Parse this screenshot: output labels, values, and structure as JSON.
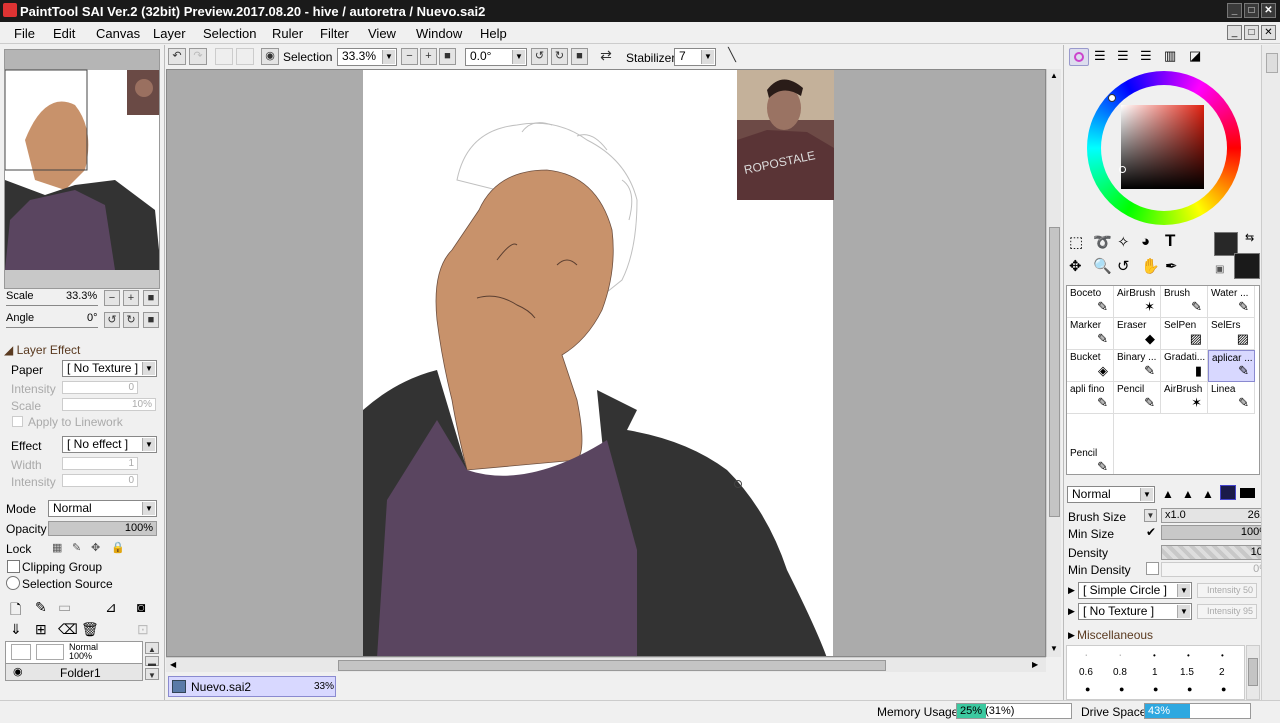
{
  "window": {
    "title": "PaintTool SAI Ver.2 (32bit) Preview.2017.08.20 - hive / autoretra / Nuevo.sai2"
  },
  "menu": [
    "File",
    "Edit",
    "Canvas",
    "Layer",
    "Selection",
    "Ruler",
    "Filter",
    "View",
    "Window",
    "Help"
  ],
  "toolbar": {
    "selection_label": "Selection",
    "zoom": "33.3%",
    "angle": "0.0°",
    "stabilizer_label": "Stabilizer",
    "stabilizer_value": "7"
  },
  "navigator": {
    "scale_label": "Scale",
    "scale_value": "33.3%",
    "angle_label": "Angle",
    "angle_value": "0°"
  },
  "layer_effect": {
    "header": "Layer Effect",
    "paper_label": "Paper",
    "paper_value": "[ No Texture ]",
    "intensity_label": "Intensity",
    "intensity_value": "0",
    "scale_label": "Scale",
    "scale_value": "10%",
    "apply_label": "Apply to Linework",
    "effect_label": "Effect",
    "effect_value": "[ No effect ]",
    "width_label": "Width",
    "width_value": "1",
    "intensity2_label": "Intensity",
    "intensity2_value": "0"
  },
  "layer_props": {
    "mode_label": "Mode",
    "mode_value": "Normal",
    "opacity_label": "Opacity",
    "opacity_value": "100%",
    "lock_label": "Lock",
    "clipping_label": "Clipping Group",
    "selsrc_label": "Selection Source"
  },
  "layers": [
    {
      "mode": "Normal",
      "opacity": "100%"
    },
    {
      "name": "Folder1"
    }
  ],
  "doc_tab": {
    "name": "Nuevo.sai2",
    "zoom": "33%"
  },
  "status": {
    "memory_label": "Memory Usage",
    "memory_value": "25% (31%)",
    "memory_fill": 0.25,
    "drive_label": "Drive Space",
    "drive_value": "43%",
    "drive_fill": 0.43
  },
  "tools": [
    {
      "name": "Boceto",
      "glyph": "✎"
    },
    {
      "name": "AirBrush",
      "glyph": "✶"
    },
    {
      "name": "Brush",
      "glyph": "✎"
    },
    {
      "name": "Water ...",
      "glyph": "✎"
    },
    {
      "name": "Marker",
      "glyph": "✎"
    },
    {
      "name": "Eraser",
      "glyph": "◆"
    },
    {
      "name": "SelPen",
      "glyph": "▨"
    },
    {
      "name": "SelErs",
      "glyph": "▨"
    },
    {
      "name": "Bucket",
      "glyph": "◈"
    },
    {
      "name": "Binary ...",
      "glyph": "✎"
    },
    {
      "name": "Gradati...",
      "glyph": "▮"
    },
    {
      "name": "aplicar ...",
      "glyph": "✎"
    },
    {
      "name": "apli fino",
      "glyph": "✎"
    },
    {
      "name": "Pencil",
      "glyph": "✎"
    },
    {
      "name": "AirBrush",
      "glyph": "✶"
    },
    {
      "name": "Linea",
      "glyph": "✎"
    },
    {
      "name": "Pencil",
      "glyph": "✎"
    }
  ],
  "brush": {
    "blend_value": "Normal",
    "size_label": "Brush Size",
    "size_mult": "x1.0",
    "size_value": "26.0",
    "minsize_label": "Min Size",
    "minsize_value": "100%",
    "density_label": "Density",
    "density_value": "100",
    "mindensity_label": "Min Density",
    "mindensity_value": "0%",
    "shape_value": "[ Simple Circle ]",
    "shape_intensity": "Intensity 50",
    "texture_value": "[ No Texture ]",
    "texture_intensity": "Intensity 95",
    "misc_label": "Miscellaneous"
  },
  "presets": [
    "0.6",
    "0.8",
    "1",
    "1.5",
    "2"
  ],
  "colors": {
    "accent": "#2ea8e0",
    "canvas_bg": "#ababab",
    "skin": "#c8926b",
    "shirt": "#5a4560",
    "jacket": "#333333",
    "primary": "#282828"
  }
}
